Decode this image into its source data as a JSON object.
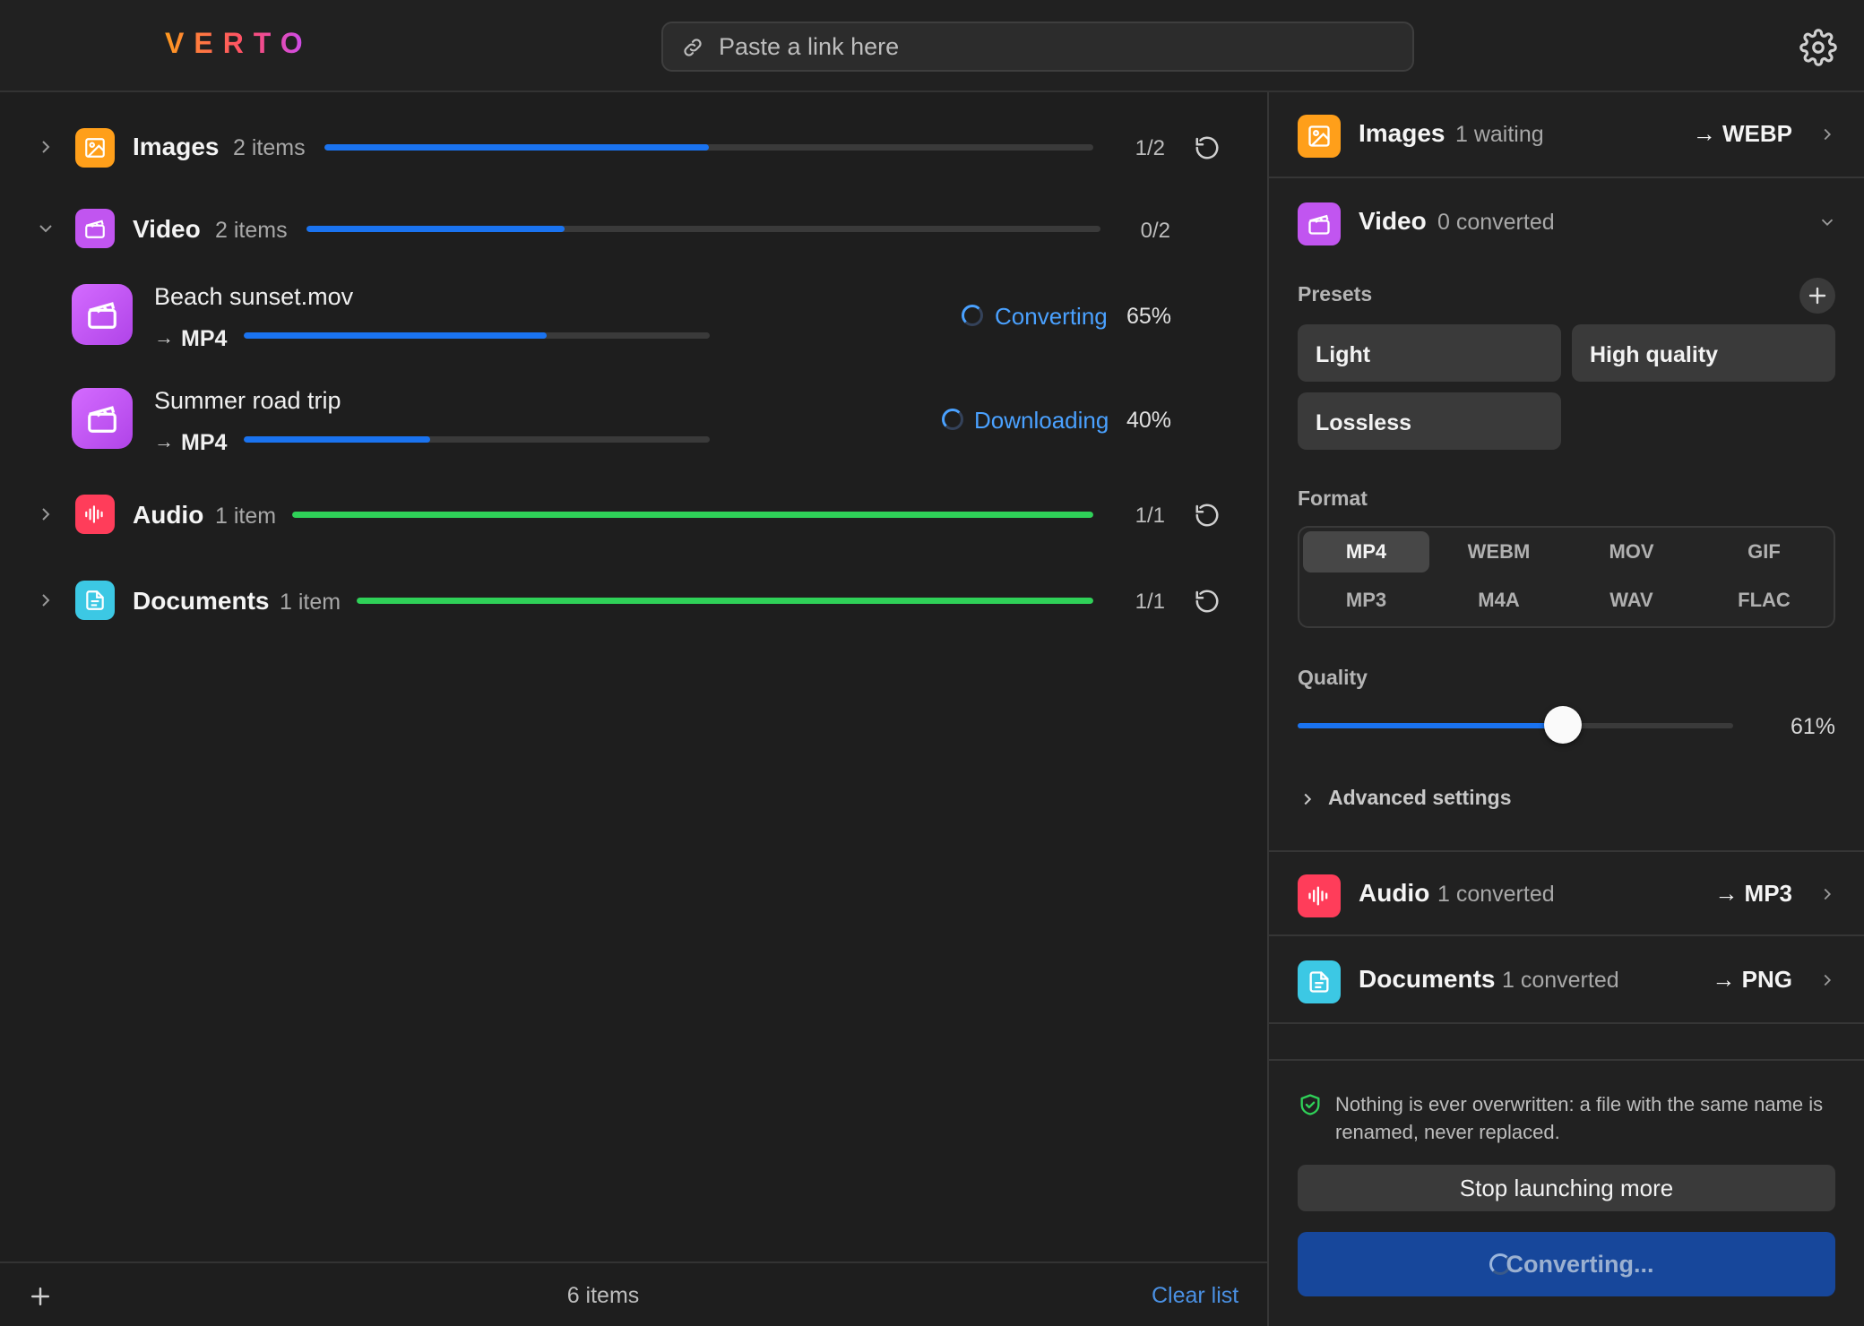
{
  "app": {
    "logo": "VERTO"
  },
  "search": {
    "placeholder": "Paste a link here"
  },
  "queue": {
    "groups": [
      {
        "name": "Images",
        "count": "2 items",
        "ratio": "1/2",
        "progress": 0.5,
        "color": "#1a73f0"
      },
      {
        "name": "Video",
        "count": "2 items",
        "ratio": "0/2",
        "progress": 0.325,
        "color": "#1a73f0",
        "files": [
          {
            "name": "Beach sunset.mov",
            "arrow": "→",
            "target": "MP4",
            "status": "Converting",
            "percent": "65%",
            "progress": 0.65
          },
          {
            "name": "Summer road trip",
            "arrow": "→",
            "target": "MP4",
            "status": "Downloading",
            "percent": "40%",
            "progress": 0.4
          }
        ]
      },
      {
        "name": "Audio",
        "count": "1 item",
        "ratio": "1/1",
        "progress": 1.0,
        "color": "#2fd158"
      },
      {
        "name": "Documents",
        "count": "1 item",
        "ratio": "1/1",
        "progress": 1.0,
        "color": "#2fd158"
      }
    ]
  },
  "footer": {
    "total": "6 items",
    "clear": "Clear list"
  },
  "panel": {
    "images": {
      "title": "Images",
      "sub": "1 waiting",
      "target": "→ WEBP"
    },
    "video": {
      "title": "Video",
      "sub": "0 converted"
    },
    "presets_label": "Presets",
    "presets": [
      "Light",
      "High quality",
      "Lossless"
    ],
    "format_label": "Format",
    "formats": [
      "MP4",
      "WEBM",
      "MOV",
      "GIF",
      "MP3",
      "M4A",
      "WAV",
      "FLAC"
    ],
    "selected_format": "MP4",
    "quality_label": "Quality",
    "quality_value": "61%",
    "quality_fraction": 0.61,
    "advanced": "Advanced settings",
    "audio": {
      "title": "Audio",
      "sub": "1 converted",
      "target": "→ MP3"
    },
    "documents": {
      "title": "Documents",
      "sub": "1 converted",
      "target": "→ PNG"
    },
    "notice": "Nothing is ever overwritten: a file with the same name is renamed, never replaced.",
    "stop": "Stop launching more",
    "convert": "Converting..."
  },
  "colors": {
    "images": "#ff9f1a",
    "video": "#c155f0",
    "audio": "#ff3d5a",
    "documents": "#3cc8e4",
    "accent": "#1a73f0",
    "success": "#2fd158",
    "status": "#4aa1ff"
  },
  "icons": {
    "link": "link-icon",
    "settings": "gear-icon",
    "images": "image-icon",
    "video": "clapperboard-icon",
    "audio": "waveform-icon",
    "documents": "document-icon",
    "retry": "retry-icon",
    "add": "plus-icon",
    "shield": "shield-check-icon",
    "chevron_right": "chevron-right-icon",
    "chevron_down": "chevron-down-icon"
  }
}
